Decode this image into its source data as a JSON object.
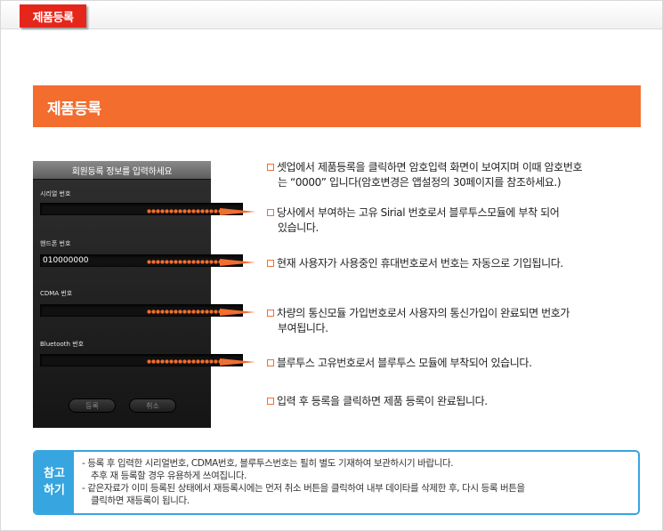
{
  "tab": {
    "label": "제품등록"
  },
  "section": {
    "title": "제품등록"
  },
  "phone": {
    "title": "회원등록 정보를 입력하세요",
    "fields": [
      {
        "label": "시리얼 번호",
        "value": ""
      },
      {
        "label": "핸드폰 번호",
        "value": "010000000"
      },
      {
        "label": "CDMA 번호",
        "value": ""
      },
      {
        "label": "Bluetooth 번호",
        "value": ""
      }
    ],
    "buttons": {
      "register": "등록",
      "cancel": "취소"
    }
  },
  "descriptions": [
    {
      "line1": "셋업에서 제품등록을 클릭하면 암호입력 화면이 보여지며 이때 암호번호",
      "line2": "는  “0000”  입니다(암호변경은 앱설정의 30페이지를 참조하세요.)"
    },
    {
      "line1": "당사에서 부여하는 고유 Sirial 번호로서 블루투스모듈에 부착 되어",
      "line2": "있습니다."
    },
    {
      "line1": "현재 사용자가 사용중인 휴대번호로서 번호는 자동으로 기입됩니다.",
      "line2": ""
    },
    {
      "line1": "차량의 통신모듈 가입번호로서 사용자의 통신가입이 완료되면 번호가",
      "line2": "부여됩니다."
    },
    {
      "line1": "블루투스 고유번호로서 블루투스 모듈에 부착되어 있습니다.",
      "line2": ""
    },
    {
      "line1": "입력 후 등록을 클릭하면 제품 등록이 완료됩니다.",
      "line2": ""
    }
  ],
  "note": {
    "label_line1": "참고",
    "label_line2": "하기",
    "lines": [
      "- 등록 후 입력한 시리얼번호, CDMA번호, 블루투스번호는 필히 별도 기재하여 보관하시기 바랍니다.",
      "추후 재 등록할 경우 유용하게 쓰여집니다.",
      "- 같은자료가 이미 등록된 상태에서 재등록시에는 먼저 취소 버튼을 클릭하여 내부 데이타를 삭제한 후, 다시 등록 버튼을",
      "클릭하면 재등록이 됩니다."
    ]
  },
  "colors": {
    "accent": "#f36d2f",
    "tab": "#e4261b",
    "note": "#36a5e0"
  }
}
